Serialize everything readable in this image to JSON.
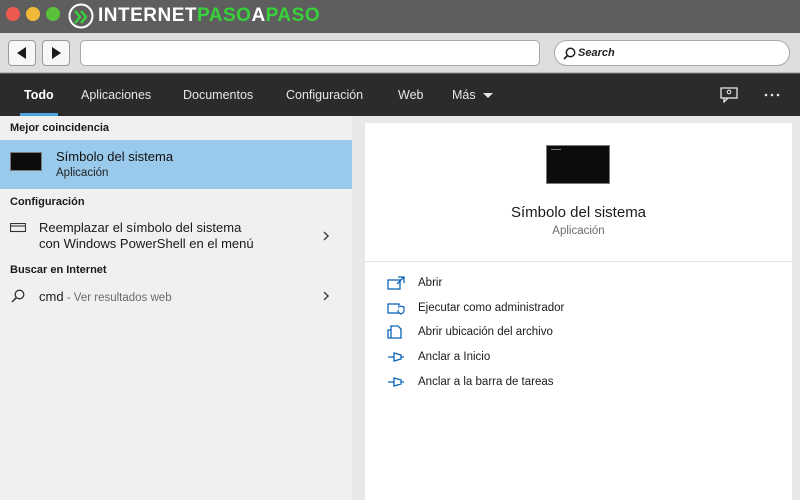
{
  "browser": {
    "logo_part1": "INTERNET",
    "logo_part2": "PASO",
    "logo_part3": "A",
    "logo_part4": "PASO",
    "search_placeholder": "Search",
    "url_value": ""
  },
  "tabs": [
    {
      "label": "Todo",
      "active": true
    },
    {
      "label": "Aplicaciones"
    },
    {
      "label": "Documentos"
    },
    {
      "label": "Configuración"
    },
    {
      "label": "Web"
    },
    {
      "label": "Más"
    }
  ],
  "left": {
    "best_match_heading": "Mejor coincidencia",
    "best_match_title": "Símbolo del sistema",
    "best_match_subtitle": "Aplicación",
    "settings_heading": "Configuración",
    "settings_item_line1": "Reemplazar el símbolo del sistema",
    "settings_item_line2": "con Windows PowerShell en el menú",
    "web_heading": "Buscar en Internet",
    "web_query": "cmd",
    "web_suffix": " - Ver resultados web"
  },
  "right": {
    "title": "Símbolo del sistema",
    "subtitle": "Aplicación",
    "actions": [
      {
        "label": "Abrir",
        "icon": "open-icon"
      },
      {
        "label": "Ejecutar como administrador",
        "icon": "run-as-admin-icon"
      },
      {
        "label": "Abrir ubicación del archivo",
        "icon": "file-location-icon"
      },
      {
        "label": "Anclar a Inicio",
        "icon": "pin-icon"
      },
      {
        "label": "Anclar a la barra de tareas",
        "icon": "pin-icon"
      }
    ]
  },
  "colors": {
    "accent": "#0b63b6",
    "selection": "#99c9eb",
    "tab_underline": "#4aa3df",
    "logo_green": "#38d13a"
  }
}
